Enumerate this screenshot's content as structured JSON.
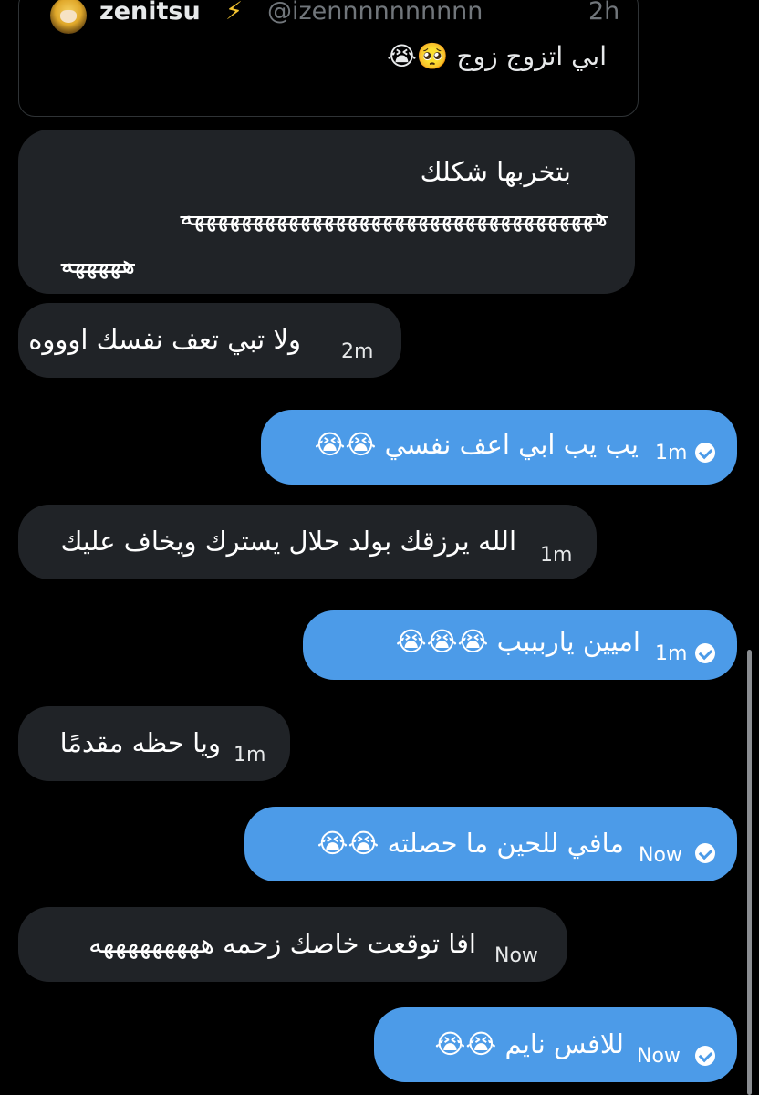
{
  "quoted_tweet": {
    "name": "zenitsu",
    "badge": "⚡",
    "handle": "@izennnnnnnnnn",
    "time": "2h",
    "text": "ابي اتزوج زوج 🥺😭"
  },
  "messages": [
    {
      "direction": "in",
      "lines": [
        "بتخربها شكلك",
        "هههههههههههههههههههههههههههههههههههه",
        "هههههه"
      ],
      "time": ""
    },
    {
      "direction": "in",
      "text": "ولا تبي تعف نفسك اوووه",
      "time": "2m"
    },
    {
      "direction": "out",
      "text": "يب يب ابي اعف نفسي 😭😭",
      "time": "1m",
      "status": "sent"
    },
    {
      "direction": "in",
      "text": "الله يرزقك بولد حلال يسترك ويخاف عليك",
      "time": "1m"
    },
    {
      "direction": "out",
      "text": "اميين ياربببب 😭😭😭",
      "time": "1m",
      "status": "sent"
    },
    {
      "direction": "in",
      "text": "ويا حظه مقدمًا",
      "time": "1m"
    },
    {
      "direction": "out",
      "text": "مافي للحين ما حصلته 😭😭",
      "time": "Now",
      "status": "sent"
    },
    {
      "direction": "in",
      "text": "افا توقعت خاصك زحمه هههههههههه",
      "time": "Now"
    },
    {
      "direction": "out",
      "text": "للافس نايم 😭😭",
      "time": "Now",
      "status": "sent"
    }
  ],
  "colors": {
    "background": "#000000",
    "incoming_bubble": "#202327",
    "outgoing_bubble": "#4c9be8",
    "muted_text": "#71767b"
  }
}
